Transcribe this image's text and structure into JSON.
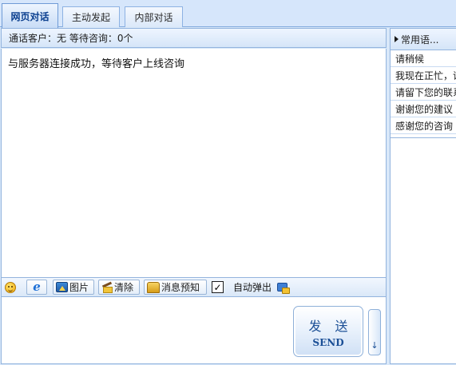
{
  "tabs": [
    {
      "label": "网页对话",
      "active": true
    },
    {
      "label": "主动发起",
      "active": false
    },
    {
      "label": "内部对话",
      "active": false
    }
  ],
  "chat": {
    "status_text": "通话客户：无 等待咨询：0个",
    "messages": [
      "与服务器连接成功，等待客户上线咨询"
    ]
  },
  "toolbar": {
    "emoji_icon": "smiley-icon",
    "browser_icon": "ie-icon",
    "picture_label": "图片",
    "clear_label": "清除",
    "notify_label": "消息预知",
    "auto_popup_label": "自动弹出",
    "auto_popup_checked": true,
    "robot_icon": "robot-icon"
  },
  "input": {
    "value": "",
    "send_cn": "发 送",
    "send_en": "SEND",
    "dropdown_icon": "down-arrow-icon"
  },
  "quick_replies": {
    "header": "常用语...",
    "items": [
      "请稍候",
      "我现在正忙，请",
      "请留下您的联系",
      "谢谢您的建议",
      "感谢您的咨询"
    ]
  },
  "colors": {
    "accent": "#0b3f8f",
    "panel_border": "#93b4de",
    "background": "#d9e8f9"
  }
}
